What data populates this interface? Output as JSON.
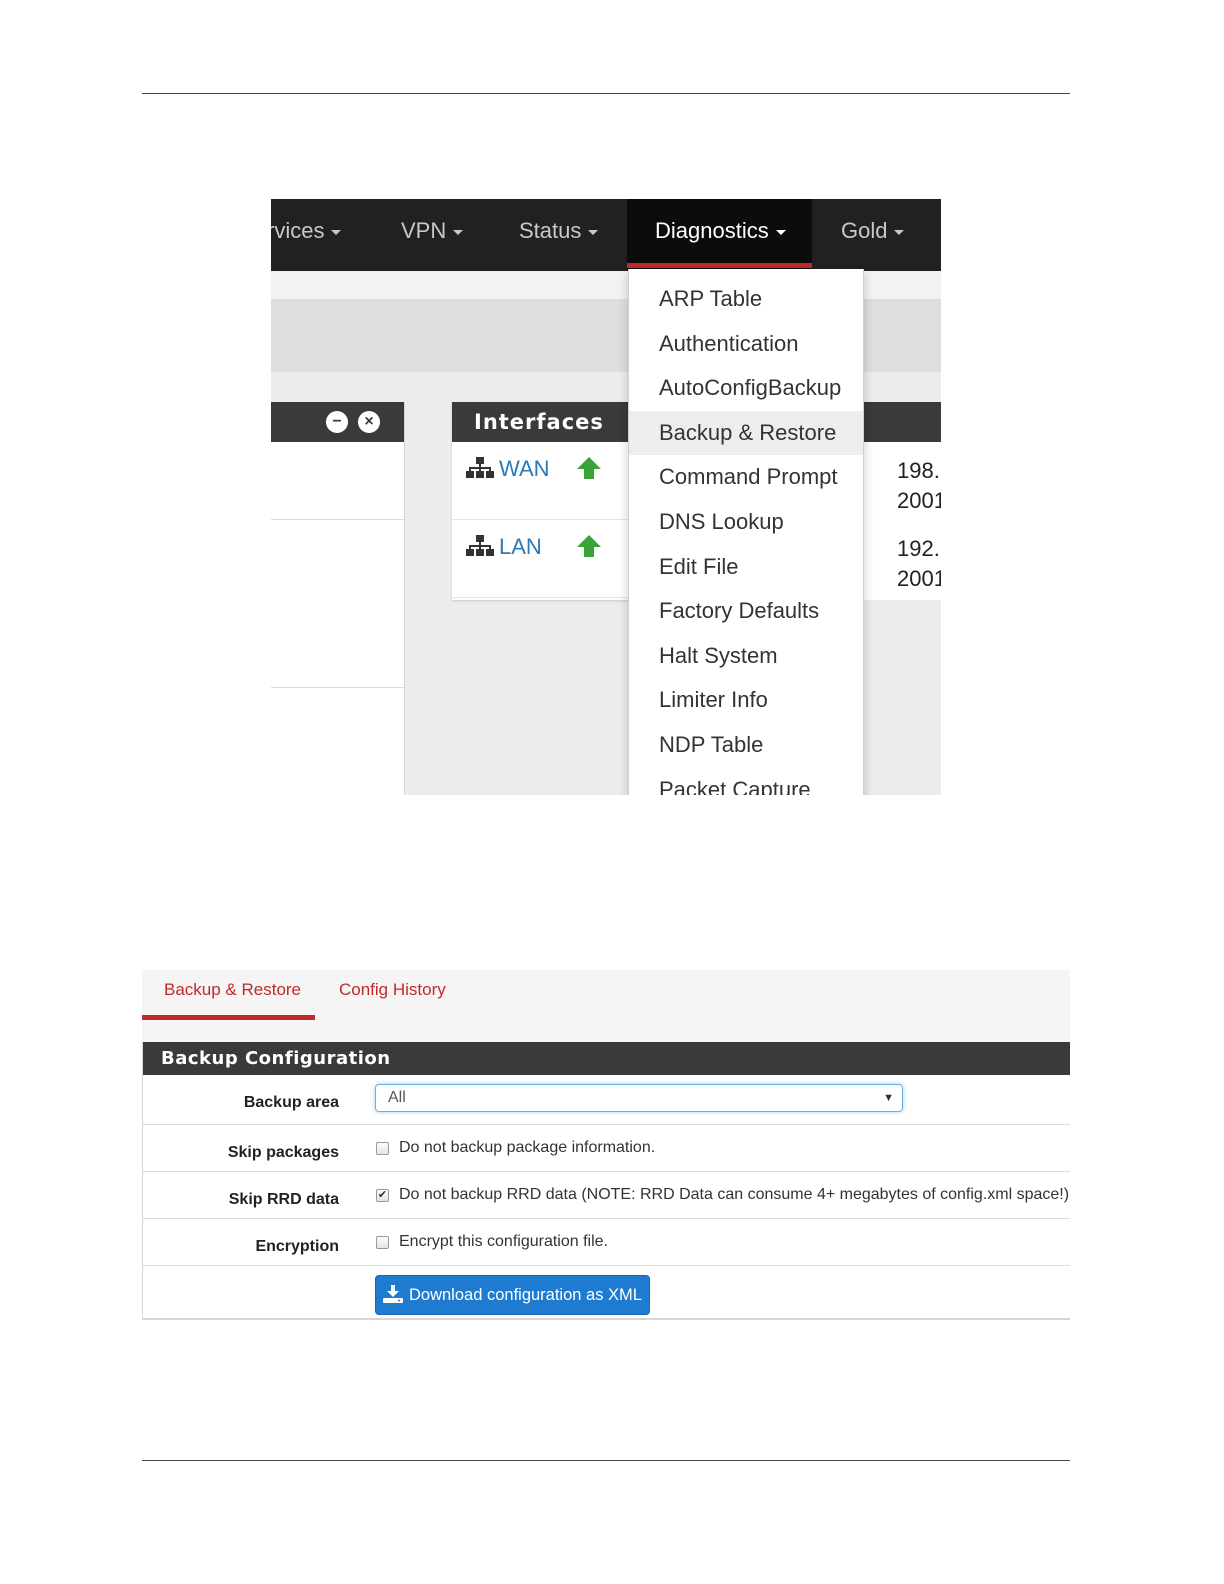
{
  "navbar": {
    "items": [
      {
        "label": "rvices"
      },
      {
        "label": "VPN"
      },
      {
        "label": "Status"
      },
      {
        "label": "Diagnostics"
      },
      {
        "label": "Gold"
      }
    ],
    "active": "Diagnostics",
    "accent_color": "#c12a2a"
  },
  "diagnostics_menu": {
    "items": [
      "ARP Table",
      "Authentication",
      "AutoConfigBackup",
      "Backup & Restore",
      "Command Prompt",
      "DNS Lookup",
      "Edit File",
      "Factory Defaults",
      "Halt System",
      "Limiter Info",
      "NDP Table",
      "Packet Capture"
    ],
    "highlighted": "Backup & Restore"
  },
  "interfaces_widget": {
    "title": "Interfaces",
    "rows": [
      {
        "name": "WAN",
        "status_icon": "arrow-up-icon",
        "addr1": "198.",
        "addr2": "2001"
      },
      {
        "name": "LAN",
        "status_icon": "arrow-up-icon",
        "addr1": "192.",
        "addr2": "2001"
      }
    ],
    "link_color": "#2a7ab8",
    "status_color": "#3aa33a"
  },
  "backup_page": {
    "tabs": [
      {
        "label": "Backup & Restore"
      },
      {
        "label": "Config History"
      }
    ],
    "active_tab": "Backup & Restore",
    "panel_title": "Backup Configuration",
    "fields": {
      "backup_area": {
        "label": "Backup area",
        "value": "All"
      },
      "skip_packages": {
        "label": "Skip packages",
        "text": "Do not backup package information.",
        "checked": false
      },
      "skip_rrd": {
        "label": "Skip RRD data",
        "text": "Do not backup RRD data (NOTE: RRD Data can consume 4+ megabytes of config.xml space!)",
        "checked": true
      },
      "encryption": {
        "label": "Encryption",
        "text": "Encrypt this configuration file.",
        "checked": false
      }
    },
    "download_button": {
      "label": "Download configuration as XML",
      "icon": "download-icon",
      "color": "#1e7bd0"
    }
  }
}
